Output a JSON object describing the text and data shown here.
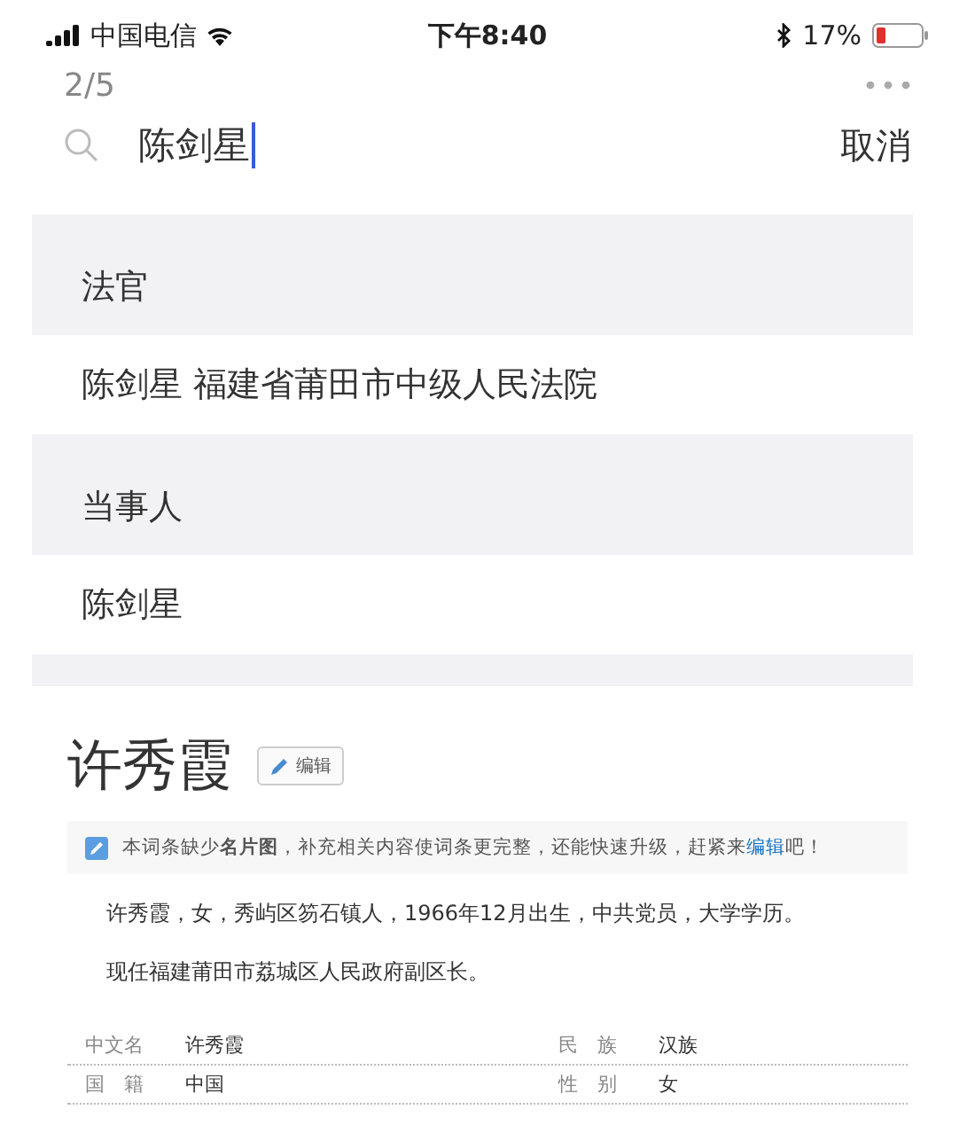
{
  "status_bar": {
    "carrier": "中国电信",
    "time": "下午8:40",
    "battery": "17%"
  },
  "page_counter": "2/5",
  "search": {
    "value": "陈剑星",
    "cancel": "取消"
  },
  "results": [
    {
      "header": "法官",
      "items": [
        "陈剑星 福建省莆田市中级人民法院"
      ]
    },
    {
      "header": "当事人",
      "items": [
        "陈剑星"
      ]
    }
  ],
  "article": {
    "title": "许秀霞",
    "edit_button": "编辑",
    "notice": {
      "text": "本词条缺少**名片图**，补充相关内容使词条更完整，还能快速升级，赶紧来",
      "link": "编辑",
      "after": "吧！"
    },
    "paragraphs": [
      "许秀霞，女，秀屿区笏石镇人，1966年12月出生，中共党员，大学学历。",
      "现任福建莆田市荔城区人民政府副区长。"
    ],
    "infobox": [
      [
        {
          "label": "中文名",
          "value": "许秀霞"
        },
        {
          "label": "民　族",
          "value": "汉族"
        }
      ],
      [
        {
          "label": "国　籍",
          "value": "中国"
        },
        {
          "label": "性　别",
          "value": "女"
        }
      ]
    ]
  }
}
